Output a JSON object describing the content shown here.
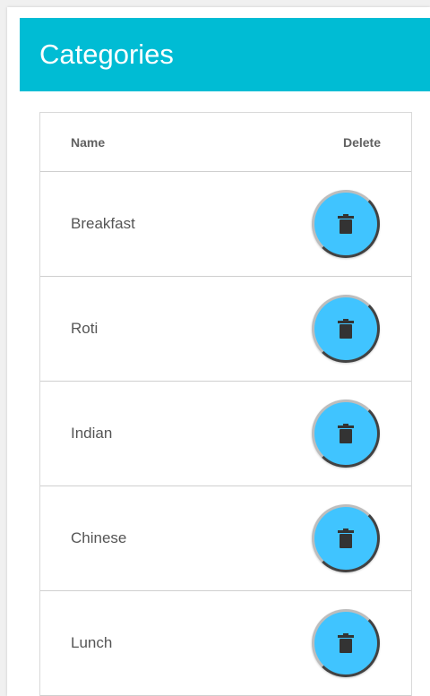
{
  "header": {
    "title": "Categories"
  },
  "table": {
    "columns": {
      "name": "Name",
      "delete": "Delete"
    },
    "rows": [
      {
        "name": "Breakfast"
      },
      {
        "name": "Roti"
      },
      {
        "name": "Indian"
      },
      {
        "name": "Chinese"
      },
      {
        "name": "Lunch"
      }
    ]
  },
  "colors": {
    "header_bg": "#00bcd4",
    "delete_button": "#40c4ff",
    "icon": "#333333"
  },
  "icons": {
    "delete": "trash-icon"
  }
}
